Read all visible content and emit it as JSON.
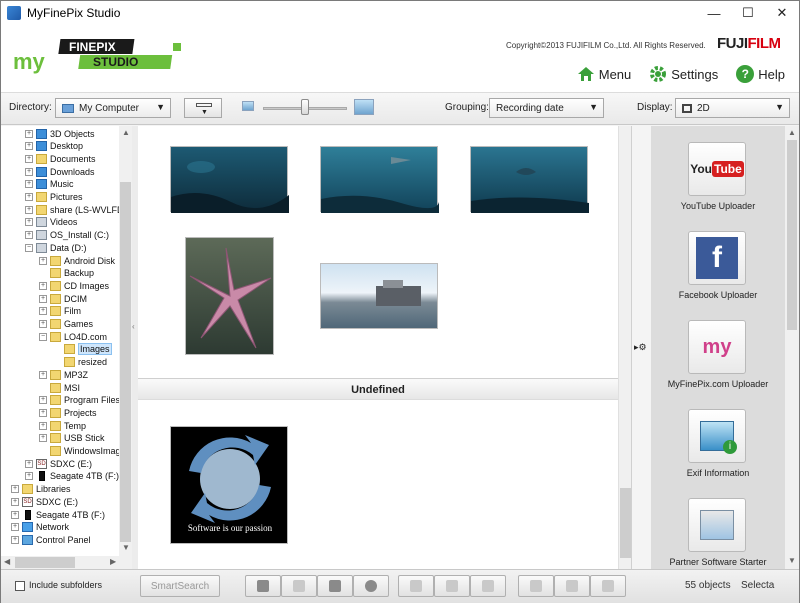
{
  "window": {
    "title": "MyFinePix Studio",
    "minimize": "—",
    "maximize": "☐",
    "close": "✕"
  },
  "header": {
    "logo_text": "myFINEPIX STUDIO",
    "logo_top": "FINEPIX",
    "logo_bottom": "STUDIO",
    "copyright": "Copyright©2013 FUJIFILM Co.,Ltd. All Rights Reserved.",
    "brand_main": "FUJI",
    "brand_accent": "FILM",
    "links": [
      {
        "label": "Menu",
        "icon": "home-icon"
      },
      {
        "label": "Settings",
        "icon": "gear-icon"
      },
      {
        "label": "Help",
        "icon": "help-icon"
      }
    ]
  },
  "toolbar": {
    "directory_label": "Directory:",
    "directory_value": "My Computer",
    "grouping_label": "Grouping:",
    "grouping_value": "Recording date",
    "display_label": "Display:",
    "display_value": "2D",
    "zoom_level": 0.5
  },
  "tree": [
    {
      "label": "3D Objects",
      "icon": "blue",
      "indent": 1,
      "exp": "+"
    },
    {
      "label": "Desktop",
      "icon": "blue",
      "indent": 1,
      "exp": "+"
    },
    {
      "label": "Documents",
      "icon": "folder",
      "indent": 1,
      "exp": "+"
    },
    {
      "label": "Downloads",
      "icon": "blue",
      "indent": 1,
      "exp": "+"
    },
    {
      "label": "Music",
      "icon": "blue",
      "indent": 1,
      "exp": "+"
    },
    {
      "label": "Pictures",
      "icon": "folder",
      "indent": 1,
      "exp": "+"
    },
    {
      "label": "share (LS-WVLFD",
      "icon": "folder",
      "indent": 1,
      "exp": "+"
    },
    {
      "label": "Videos",
      "icon": "drive",
      "indent": 1,
      "exp": "+"
    },
    {
      "label": "OS_Install (C:)",
      "icon": "drive",
      "indent": 1,
      "exp": "+"
    },
    {
      "label": "Data (D:)",
      "icon": "drive",
      "indent": 1,
      "exp": "−"
    },
    {
      "label": "Android Disk",
      "icon": "folder",
      "indent": 2,
      "exp": "+"
    },
    {
      "label": "Backup",
      "icon": "folder",
      "indent": 2,
      "exp": ""
    },
    {
      "label": "CD Images",
      "icon": "folder",
      "indent": 2,
      "exp": "+"
    },
    {
      "label": "DCIM",
      "icon": "folder",
      "indent": 2,
      "exp": "+"
    },
    {
      "label": "Film",
      "icon": "folder",
      "indent": 2,
      "exp": "+"
    },
    {
      "label": "Games",
      "icon": "folder",
      "indent": 2,
      "exp": "+"
    },
    {
      "label": "LO4D.com",
      "icon": "folder",
      "indent": 2,
      "exp": "−"
    },
    {
      "label": "Images",
      "icon": "folder",
      "indent": 3,
      "exp": "",
      "selected": true
    },
    {
      "label": "resized",
      "icon": "folder",
      "indent": 3,
      "exp": ""
    },
    {
      "label": "MP3Z",
      "icon": "folder",
      "indent": 2,
      "exp": "+"
    },
    {
      "label": "MSI",
      "icon": "folder",
      "indent": 2,
      "exp": ""
    },
    {
      "label": "Program Files",
      "icon": "folder",
      "indent": 2,
      "exp": "+"
    },
    {
      "label": "Projects",
      "icon": "folder",
      "indent": 2,
      "exp": "+"
    },
    {
      "label": "Temp",
      "icon": "folder",
      "indent": 2,
      "exp": "+"
    },
    {
      "label": "USB Stick",
      "icon": "folder",
      "indent": 2,
      "exp": "+"
    },
    {
      "label": "WindowsImag",
      "icon": "folder",
      "indent": 2,
      "exp": ""
    },
    {
      "label": "SDXC (E:)",
      "icon": "sd",
      "indent": 1,
      "exp": "+"
    },
    {
      "label": "Seagate 4TB (F:)",
      "icon": "black",
      "indent": 1,
      "exp": "+"
    },
    {
      "label": "Libraries",
      "icon": "folder",
      "indent": 0,
      "exp": "+"
    },
    {
      "label": "SDXC (E:)",
      "icon": "sd",
      "indent": 0,
      "exp": "+"
    },
    {
      "label": "Seagate 4TB (F:)",
      "icon": "black",
      "indent": 0,
      "exp": "+"
    },
    {
      "label": "Network",
      "icon": "net",
      "indent": 0,
      "exp": "+"
    },
    {
      "label": "Control Panel",
      "icon": "cp",
      "indent": 0,
      "exp": "+"
    }
  ],
  "main": {
    "group_label": "Undefined",
    "logo_caption": "Software is our passion"
  },
  "uploaders": [
    {
      "label": "YouTube Uploader",
      "badge": "You",
      "badge2": "Tube"
    },
    {
      "label": "Facebook Uploader",
      "badge": "f"
    },
    {
      "label": "MyFinePix.com Uploader",
      "badge": "my"
    },
    {
      "label": "Exif Information",
      "badge": "i"
    },
    {
      "label": "Partner Software Starter",
      "badge": ""
    }
  ],
  "status": {
    "include_subfolders": "Include subfolders",
    "smartsearch": "SmartSearch",
    "count_text": "55 objects",
    "select_text": "Selecta"
  },
  "colors": {
    "accent_green": "#3aa03a",
    "fuji_red": "#d7000f",
    "logo_green": "#6cbf3c"
  }
}
